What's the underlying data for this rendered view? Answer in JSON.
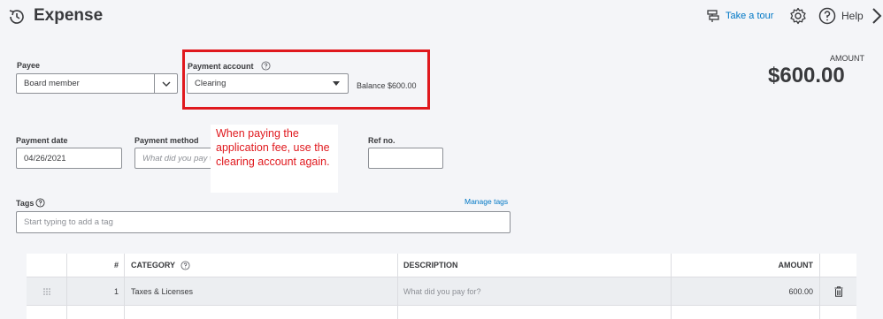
{
  "header": {
    "title": "Expense",
    "take_tour": "Take a tour",
    "help": "Help"
  },
  "payee": {
    "label": "Payee",
    "value": "Board member"
  },
  "payment_account": {
    "label": "Payment account",
    "value": "Clearing",
    "balance": "Balance $600.00"
  },
  "amount": {
    "label": "AMOUNT",
    "value": "$600.00"
  },
  "payment_date": {
    "label": "Payment date",
    "value": "04/26/2021"
  },
  "payment_method": {
    "label": "Payment method",
    "placeholder": "What did you pay w"
  },
  "ref_no": {
    "label": "Ref no.",
    "value": ""
  },
  "annotation": {
    "text": "When paying the application fee, use the clearing account again.",
    "color": "#e0191e"
  },
  "tags": {
    "label": "Tags",
    "manage": "Manage tags",
    "placeholder": "Start typing to add a tag"
  },
  "table": {
    "headers": [
      "#",
      "CATEGORY",
      "DESCRIPTION",
      "AMOUNT"
    ],
    "rows": [
      {
        "num": "1",
        "category": "Taxes & Licenses",
        "description_placeholder": "What did you pay for?",
        "amount": "600.00"
      }
    ]
  },
  "colors": {
    "link": "#0077c5",
    "text": "#393a3d",
    "background": "#f4f5f8"
  }
}
